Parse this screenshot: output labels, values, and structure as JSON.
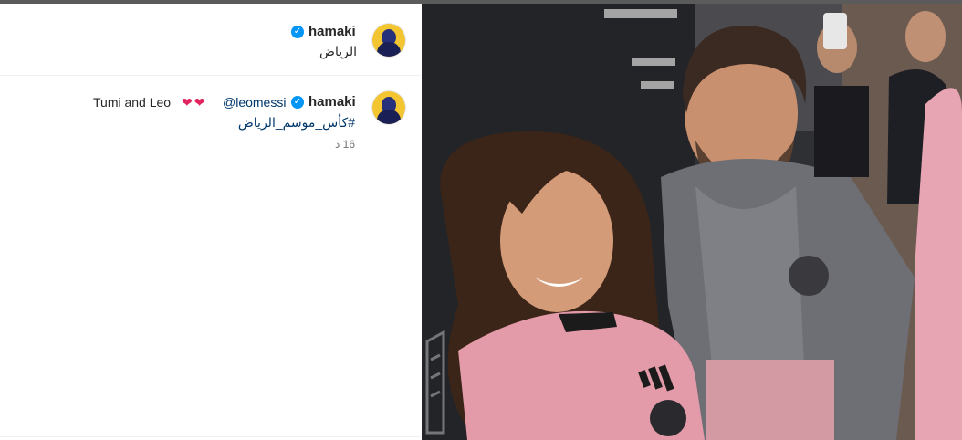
{
  "post": {
    "author": {
      "username": "hamaki",
      "verified_icon": "verified-badge-icon",
      "location": "الرياض"
    },
    "caption": {
      "username": "hamaki",
      "mention": "@leomessi",
      "hearts": "❤❤",
      "text": "Tumi and Leo",
      "hashtag": "#كأس_موسم_الرياض",
      "time": "16 د"
    }
  },
  "colors": {
    "verified": "#0095f6",
    "link": "#00376b",
    "heart": "#e0245e",
    "avatar_bg": "#f2c531"
  }
}
